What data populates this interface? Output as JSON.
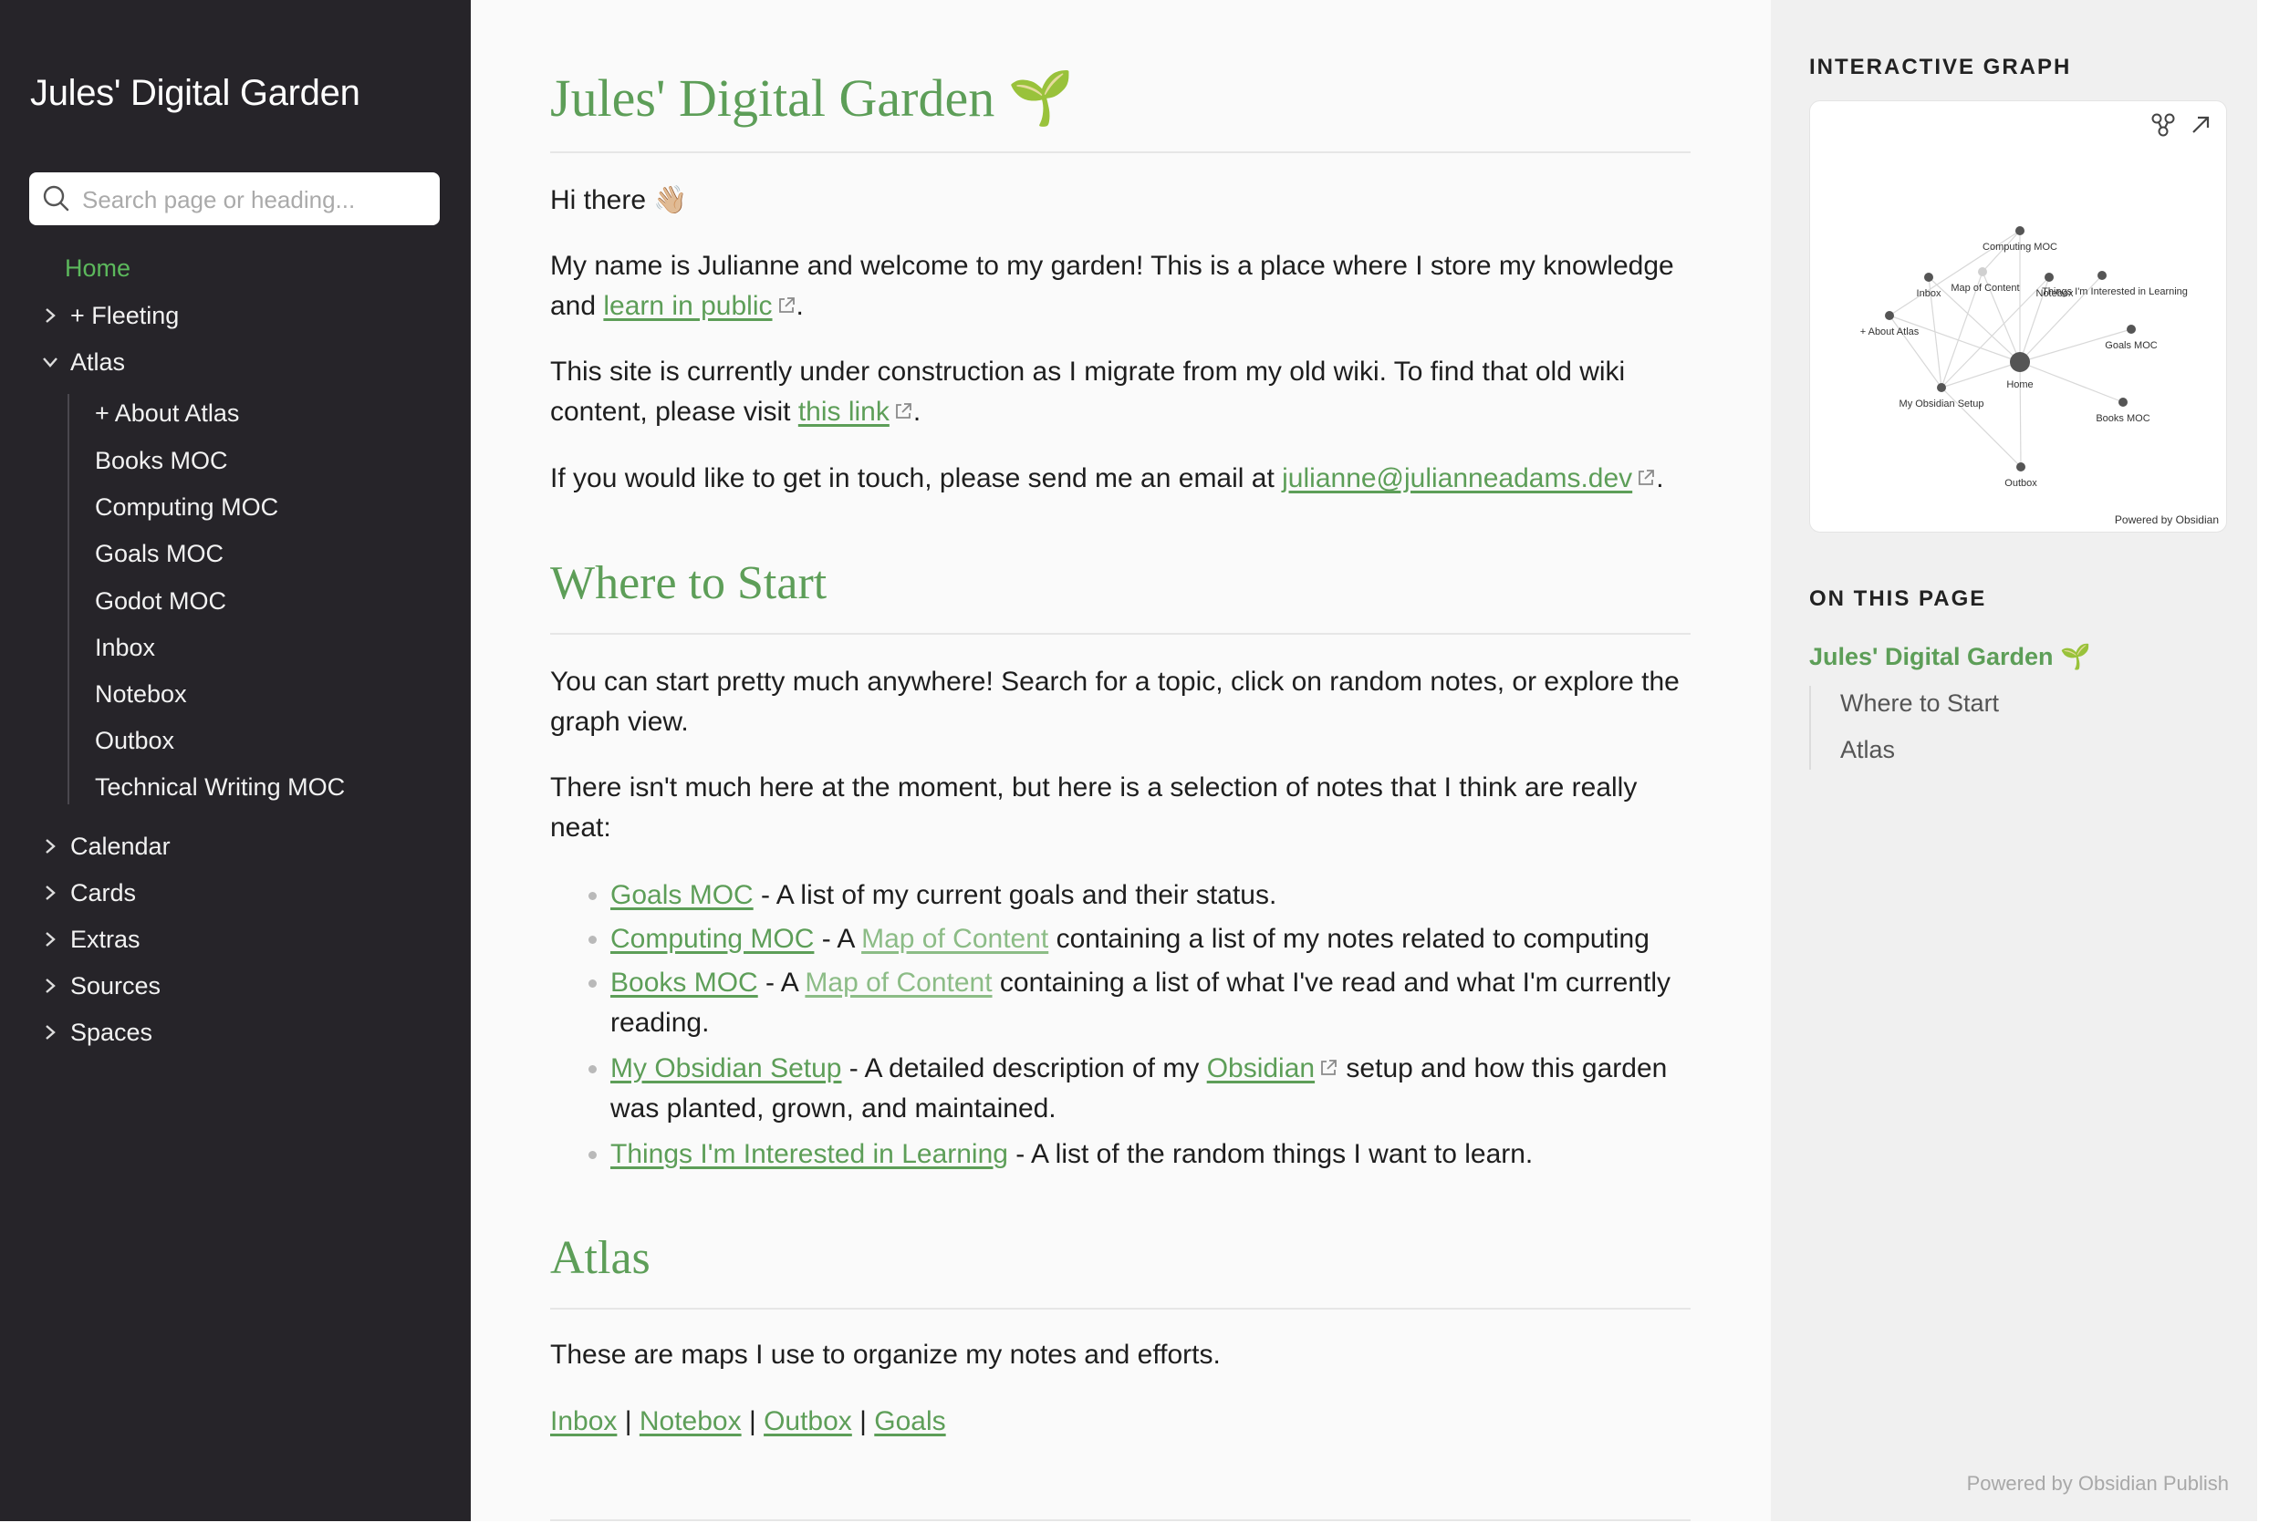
{
  "sidebar": {
    "site_name": "Jules' Digital Garden",
    "search_placeholder": "Search page or heading...",
    "items": [
      {
        "label": "Home",
        "active": true
      },
      {
        "label": "+ Fleeting",
        "expanded": false
      },
      {
        "label": "Atlas",
        "expanded": true
      },
      {
        "label": "Calendar",
        "expanded": false
      },
      {
        "label": "Cards",
        "expanded": false
      },
      {
        "label": "Extras",
        "expanded": false
      },
      {
        "label": "Sources",
        "expanded": false
      },
      {
        "label": "Spaces",
        "expanded": false
      }
    ],
    "atlas_children": [
      "+ About Atlas",
      "Books MOC",
      "Computing MOC",
      "Goals MOC",
      "Godot MOC",
      "Inbox",
      "Notebox",
      "Outbox",
      "Technical Writing MOC"
    ]
  },
  "main": {
    "title": "Jules' Digital Garden",
    "title_emoji": "🌱",
    "greeting": "Hi there",
    "greeting_emoji": "👋🏼",
    "intro": {
      "text_before": "My name is Julianne and welcome to my garden! This is a place where I store my knowledge and ",
      "link": "learn in public",
      "text_after": "."
    },
    "construction": {
      "text_before": "This site is currently under construction as I migrate from my old wiki. To find that old wiki content, please visit ",
      "link": "this link",
      "text_after": "."
    },
    "contact": {
      "text_before": "If you would like to get in touch, please send me an email at ",
      "link": "julianne@julianneadams.dev",
      "text_after": "."
    },
    "where_to_start": {
      "heading": "Where to Start",
      "p1": "You can start pretty much anywhere! Search for a topic, click on random notes, or explore the graph view.",
      "p2": "There isn't much here at the moment, but here is a selection of notes that I think are really neat:",
      "list": [
        {
          "link": "Goals MOC",
          "text": " - A list of my current goals and their status."
        },
        {
          "link": "Computing MOC",
          "mid": " - A ",
          "link2": "Map of Content",
          "text": " containing a list of my notes related to computing"
        },
        {
          "link": "Books MOC",
          "mid": " - A ",
          "link2": "Map of Content",
          "text": " containing a list of what I've read and what I'm currently reading."
        },
        {
          "link": "My Obsidian Setup",
          "mid": " - A detailed description of my ",
          "link2": "Obsidian",
          "text": " setup and how this garden was planted, grown, and maintained."
        },
        {
          "link": "Things I'm Interested in Learning",
          "text": " - A list of the random things I want to learn."
        }
      ]
    },
    "atlas": {
      "heading": "Atlas",
      "p1": "These are maps I use to organize my notes and efforts.",
      "links": [
        "Inbox",
        "Notebox",
        "Outbox",
        "Goals"
      ],
      "separator": " | "
    }
  },
  "right_panel": {
    "graph_title": "INTERACTIVE GRAPH",
    "graph_nodes": [
      "Computing MOC",
      "Inbox",
      "Map of Content",
      "Notebox",
      "Things I'm Interested in Learning",
      "+ About Atlas",
      "Goals MOC",
      "Home",
      "My Obsidian Setup",
      "Books MOC",
      "Outbox"
    ],
    "graph_powered": "Powered by Obsidian",
    "toc_title": "ON THIS PAGE",
    "toc": [
      "Jules' Digital Garden",
      "Where to Start",
      "Atlas"
    ],
    "toc_emoji": "🌱",
    "footer": "Powered by Obsidian Publish"
  },
  "colors": {
    "sidebar_bg": "#262429",
    "accent": "#5d9e58",
    "accent_soft": "#8cbc86",
    "right_bg": "#f0f0f0",
    "main_bg": "#fafafa"
  }
}
